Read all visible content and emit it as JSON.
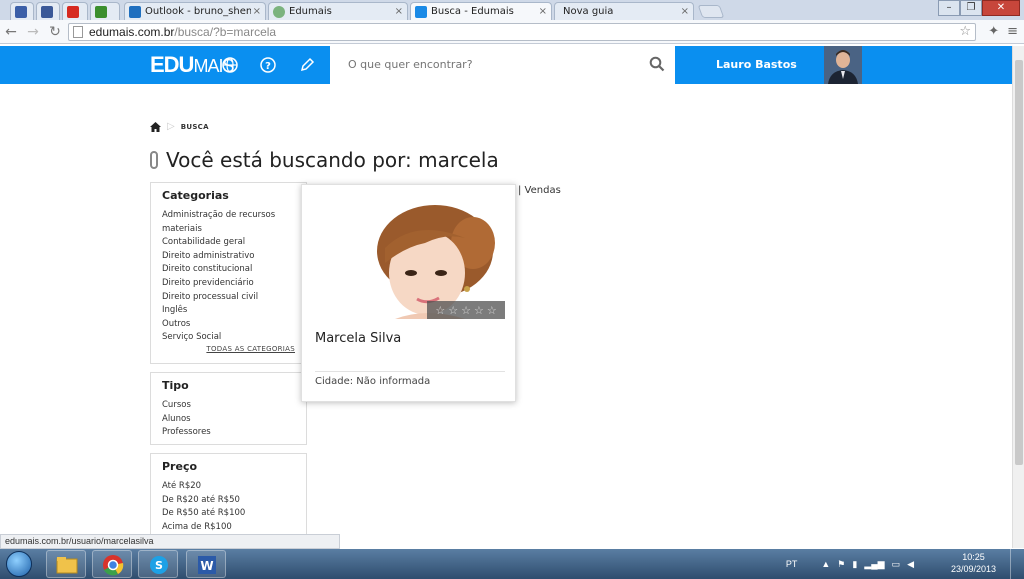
{
  "browser": {
    "tabs": [
      {
        "label": "",
        "favicon_color": "#3b5fa8"
      },
      {
        "label": "",
        "favicon_color": "#3b5998"
      },
      {
        "label": "",
        "favicon_color": "#d62a21"
      },
      {
        "label": "",
        "favicon_color": "#3b8f2e"
      },
      {
        "label": "Outlook - bruno_shenn@",
        "favicon_color": "#1f6fbf"
      },
      {
        "label": "Edumais",
        "favicon_color": "#7bb37e"
      },
      {
        "label": "Busca - Edumais",
        "favicon_color": "#1a8ae6"
      },
      {
        "label": "Nova guia",
        "favicon_color": ""
      }
    ],
    "url_host": "edumais.com.br",
    "url_path": "/busca/?b=marcela",
    "status_url": "edumais.com.br/usuario/marcelasilva"
  },
  "header": {
    "logo_main": "EDU",
    "logo_sub": "MAIS",
    "search_placeholder": "O que quer encontrar?",
    "user_name": "Lauro Bastos"
  },
  "breadcrumb": {
    "current": "BUSCA"
  },
  "page": {
    "title": "Você está buscando por: marcela"
  },
  "sidebar": {
    "categories": {
      "title": "Categorias",
      "items": [
        "Administração de recursos materiais",
        "Contabilidade geral",
        "Direito administrativo",
        "Direito constitucional",
        "Direito previdenciário",
        "Direito processual civil",
        "Inglês",
        "Outros",
        "Serviço Social"
      ],
      "all_label": "TODAS AS CATEGORIAS"
    },
    "type": {
      "title": "Tipo",
      "items": [
        "Cursos",
        "Alunos",
        "Professores"
      ]
    },
    "price": {
      "title": "Preço",
      "items": [
        "Até R$20",
        "De R$20 até R$50",
        "De R$50 até R$100",
        "Acima de R$100"
      ]
    }
  },
  "sort_bar": {
    "visible_fragment": "| Vendas"
  },
  "result_card": {
    "name": "Marcela Silva",
    "city": "Cidade: Não informada",
    "rating": 0,
    "rating_max": 5
  },
  "taskbar": {
    "language": "PT",
    "time": "10:25",
    "date": "23/09/2013"
  }
}
